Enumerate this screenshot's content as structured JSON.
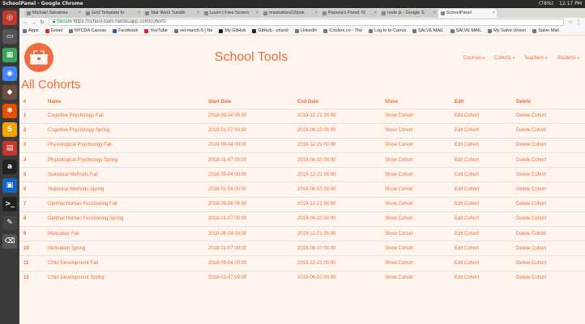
{
  "os": {
    "window_title": "SchoolPanel - Google Chrome",
    "battery": "(78%)",
    "time": "12:17 PM"
  },
  "browser": {
    "tabs": [
      {
        "label": "Michael Salvatore"
      },
      {
        "label": "Grid Template fo"
      },
      {
        "label": "Star Wars Tumblr"
      },
      {
        "label": "Loom | Free Screen"
      },
      {
        "label": "msalvatore22/pok"
      },
      {
        "label": "Pamela's Panel: M"
      },
      {
        "label": "node.js - Google S"
      },
      {
        "label": "SchoolPanel"
      }
    ],
    "address": {
      "secure_label": "Secure",
      "url": "https://school-tools.herokuapp.com/cohorts"
    },
    "bookmarks": [
      {
        "label": "Apps"
      },
      {
        "label": "Gmail"
      },
      {
        "label": "NYCDA Canvas"
      },
      {
        "label": "Facebook"
      },
      {
        "label": "YouTube"
      },
      {
        "label": "sei-march-5 | Ne"
      },
      {
        "label": "My GitHub"
      },
      {
        "label": "GitHub - orland"
      },
      {
        "label": "LinkedIn"
      },
      {
        "label": "Coolors.co - The"
      },
      {
        "label": "Log In to Canva"
      },
      {
        "label": "SALVE MAIL"
      },
      {
        "label": "SALVE MAIL"
      },
      {
        "label": "My Salve Univer"
      },
      {
        "label": "Salve Mail"
      }
    ]
  },
  "navbar": {
    "brand": "School Tools",
    "links": [
      {
        "label": "Courses"
      },
      {
        "label": "Cohorts"
      },
      {
        "label": "Teachers"
      },
      {
        "label": "Students"
      }
    ]
  },
  "page": {
    "heading": "All Cohorts",
    "columns": [
      "#",
      "Name",
      "Start Date",
      "End Date",
      "Show",
      "Edit",
      "Delete"
    ],
    "rows": [
      {
        "id": "1",
        "name": "Cognitive Psychology Fall",
        "start": "2018-09-04 00:00",
        "end": "2019-12-21 00:00",
        "show": "Show Cohort",
        "edit": "Edit Cohort",
        "delete": "Delete Cohort"
      },
      {
        "id": "2",
        "name": "Cognitive Psychology Spring",
        "start": "2018-01-07 00:00",
        "end": "2019-06-10 00:00",
        "show": "Show Cohort",
        "edit": "Edit Cohort",
        "delete": "Delete Cohort"
      },
      {
        "id": "3",
        "name": "Physiological Psychology Fall",
        "start": "2018-09-04 00:00",
        "end": "2019-12-21 00:00",
        "show": "Show Cohort",
        "edit": "Edit Cohort",
        "delete": "Delete Cohort"
      },
      {
        "id": "4",
        "name": "Physiological Psychology Spring",
        "start": "2018-01-07 00:00",
        "end": "2019-06-10 00:00",
        "show": "Show Cohort",
        "edit": "Edit Cohort",
        "delete": "Delete Cohort"
      },
      {
        "id": "5",
        "name": "Statistical Methods Fall",
        "start": "2018-09-04 00:00",
        "end": "2019-12-21 00:00",
        "show": "Show Cohort",
        "edit": "Edit Cohort",
        "delete": "Delete Cohort"
      },
      {
        "id": "6",
        "name": "Statistical Methods Spring",
        "start": "2018-01-04 00:00",
        "end": "2019-06-10 00:00",
        "show": "Show Cohort",
        "edit": "Edit Cohort",
        "delete": "Delete Cohort"
      },
      {
        "id": "7",
        "name": "Optimal Human Functioning Fall",
        "start": "2018-09-04 00:00",
        "end": "2019-12-21 00:00",
        "show": "Show Cohort",
        "edit": "Edit Cohort",
        "delete": "Delete Cohort"
      },
      {
        "id": "8",
        "name": "Optimal Human Functioning Spring",
        "start": "2018-01-07 00:00",
        "end": "2019-06-10 00:00",
        "show": "Show Cohort",
        "edit": "Edit Cohort",
        "delete": "Delete Cohort"
      },
      {
        "id": "9",
        "name": "Motivation Fall",
        "start": "2018-09-04 00:00",
        "end": "2019-12-21 00:00",
        "show": "Show Cohort",
        "edit": "Edit Cohort",
        "delete": "Delete Cohort"
      },
      {
        "id": "10",
        "name": "Motivation Spring",
        "start": "2018-01-07 00:00",
        "end": "2019-06-10 00:00",
        "show": "Show Cohort",
        "edit": "Edit Cohort",
        "delete": "Delete Cohort"
      },
      {
        "id": "11",
        "name": "Child Development Fall",
        "start": "2018-09-04 00:00",
        "end": "2019-12-21 00:00",
        "show": "Show Cohort",
        "edit": "Edit Cohort",
        "delete": "Delete Cohort"
      },
      {
        "id": "12",
        "name": "Child Development Spring",
        "start": "2018-01-07 00:00",
        "end": "2019-06-10 00:00",
        "show": "Show Cohort",
        "edit": "Edit Cohort",
        "delete": "Delete Cohort"
      }
    ]
  },
  "colors": {
    "accent": "#f06b3e",
    "page_background": "#fff5ef"
  }
}
